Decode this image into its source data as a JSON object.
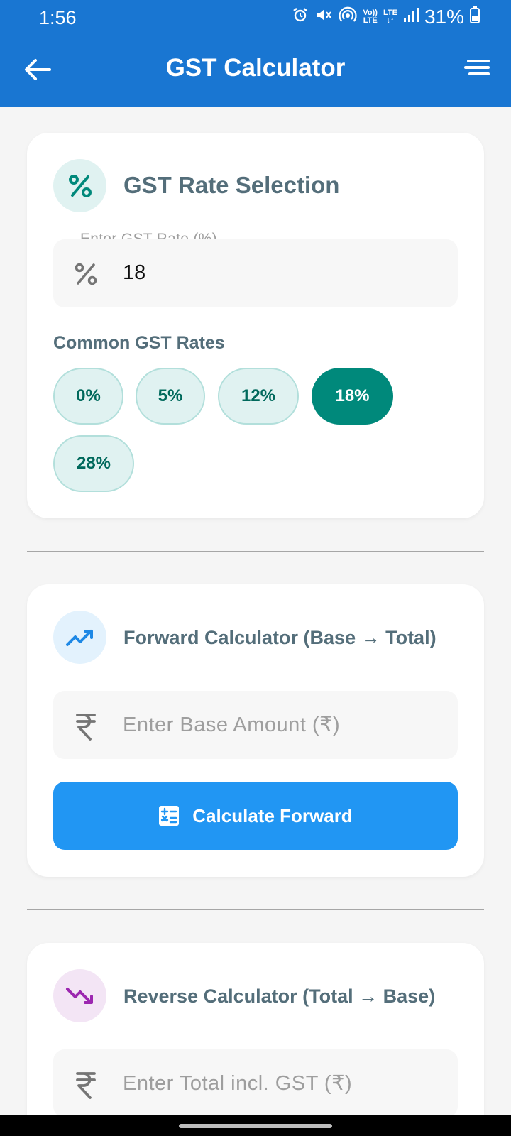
{
  "status_bar": {
    "time": "1:56",
    "volte_top": "Vo))",
    "volte_bottom": "LTE",
    "lte": "LTE",
    "battery": "31%"
  },
  "app_bar": {
    "title": "GST Calculator"
  },
  "rate_card": {
    "title": "GST Rate Selection",
    "field_label": "Enter GST Rate (%)",
    "field_value": "18",
    "section_label": "Common GST Rates",
    "chips": [
      {
        "label": "0%",
        "selected": false
      },
      {
        "label": "5%",
        "selected": false
      },
      {
        "label": "12%",
        "selected": false
      },
      {
        "label": "18%",
        "selected": true
      },
      {
        "label": "28%",
        "selected": false
      }
    ]
  },
  "forward_card": {
    "title": "Forward Calculator (Base → Total)",
    "placeholder": "Enter Base Amount (₹)",
    "button_label": "Calculate Forward"
  },
  "reverse_card": {
    "title": "Reverse Calculator (Total → Base)",
    "placeholder": "Enter Total incl. GST (₹)"
  },
  "colors": {
    "app_bar": "#1976d2",
    "teal_accent": "#00897b",
    "blue_button": "#2196f3",
    "purple_accent": "#9c27b0"
  },
  "icons": {
    "rate_head": "percent-icon",
    "rate_field": "percent-icon",
    "forward_head": "trending-up-icon",
    "forward_field": "rupee-icon",
    "forward_button": "calculator-icon",
    "reverse_head": "trending-down-icon",
    "reverse_field": "rupee-icon"
  }
}
